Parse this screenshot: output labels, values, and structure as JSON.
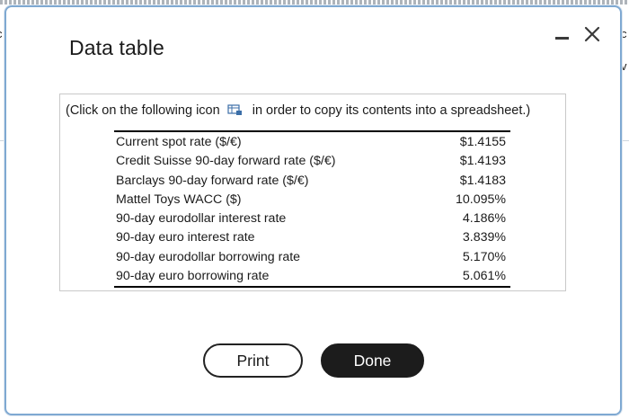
{
  "dialog": {
    "title": "Data table",
    "instruction_before": "(Click on the following icon",
    "instruction_after": "in order to copy its contents into a spreadsheet.)"
  },
  "table": {
    "rows": [
      {
        "label": "Current spot rate ($/€)",
        "value": "$1.4155"
      },
      {
        "label": "Credit Suisse 90-day forward rate ($/€)",
        "value": "$1.4193"
      },
      {
        "label": "Barclays 90-day forward rate ($/€)",
        "value": "$1.4183"
      },
      {
        "label": "Mattel Toys WACC ($)",
        "value": "10.095%"
      },
      {
        "label": "90-day eurodollar interest rate",
        "value": "4.186%"
      },
      {
        "label": "90-day euro interest rate",
        "value": "3.839%"
      },
      {
        "label": "90-day eurodollar borrowing rate",
        "value": "5.170%"
      },
      {
        "label": "90-day euro borrowing rate",
        "value": "5.061%"
      }
    ]
  },
  "buttons": {
    "print_label": "Print",
    "done_label": "Done"
  },
  "icons": {
    "minimize": "minimize-icon",
    "close": "close-icon",
    "copy": "spreadsheet-copy-icon"
  },
  "colors": {
    "dialog_border": "#7fa9d2",
    "done_button": "#1c1c1c"
  }
}
